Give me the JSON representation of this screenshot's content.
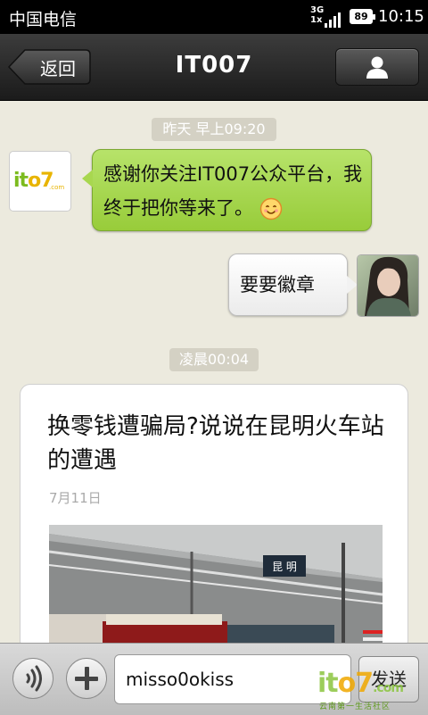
{
  "status_bar": {
    "carrier": "中国电信",
    "network": "3G",
    "network_sub": "1x",
    "battery": "89",
    "time": "10:15"
  },
  "title_bar": {
    "back_label": "返回",
    "title": "IT007",
    "profile_icon": "person-icon"
  },
  "messages": {
    "timestamp_1": "昨天 早上09:20",
    "welcome_text": "感谢你关注IT007公众平台，我终于把你等来了。",
    "user_text": "要要徽章",
    "timestamp_2": "凌晨00:04",
    "article_title": "换零钱遭骗局?说说在昆明火车站的遭遇",
    "article_date": "7月11日",
    "photo_sign": "昆 明"
  },
  "official_logo": {
    "text_a": "it",
    "text_b": "o7",
    "domain": ".com"
  },
  "input_bar": {
    "voice_icon": "voice-icon",
    "plus_icon": "plus-icon",
    "input_value": "misso0okiss",
    "send_label": "发送"
  },
  "watermark": {
    "logo_a": "it",
    "logo_b": "o7",
    "domain": ".com",
    "tagline": "云南第一生活社区"
  },
  "colors": {
    "green_bubble": "#a8d74f",
    "title_bar": "#2a2a2a",
    "background": "#eceade"
  }
}
